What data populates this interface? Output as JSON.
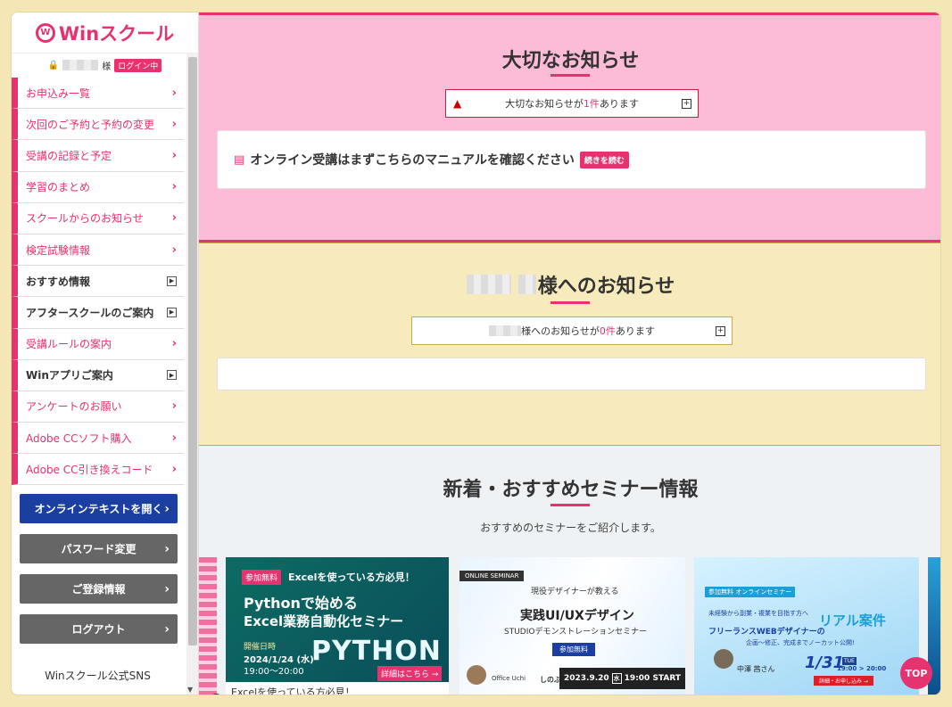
{
  "logo": {
    "text": "Winスクール",
    "mark": "W"
  },
  "user": {
    "suffix": "様",
    "badge": "ログイン中"
  },
  "sidebar": {
    "items": [
      {
        "label": "お申込み一覧",
        "kind": "arrow"
      },
      {
        "label": "次回のご予約と予約の変更",
        "kind": "arrow"
      },
      {
        "label": "受講の記録と予定",
        "kind": "arrow"
      },
      {
        "label": "学習のまとめ",
        "kind": "arrow"
      },
      {
        "label": "スクールからのお知らせ",
        "kind": "arrow"
      },
      {
        "label": "検定試験情報",
        "kind": "arrow"
      },
      {
        "label": "おすすめ情報",
        "kind": "box"
      },
      {
        "label": "アフタースクールのご案内",
        "kind": "box"
      },
      {
        "label": "受講ルールの案内",
        "kind": "arrow"
      },
      {
        "label": "Winアプリご案内",
        "kind": "box"
      },
      {
        "label": "アンケートのお願い",
        "kind": "arrow"
      },
      {
        "label": "Adobe CCソフト購入",
        "kind": "arrow"
      },
      {
        "label": "Adobe CC引き換えコード",
        "kind": "arrow"
      }
    ],
    "buttons": {
      "online_text": "オンラインテキストを開く",
      "password": "パスワード変更",
      "registration": "ご登録情報",
      "logout": "ログアウト"
    },
    "sns": "Winスクール公式SNS"
  },
  "important": {
    "title": "大切なお知らせ",
    "notice_pre": "大切なお知らせが",
    "notice_count": "1件",
    "notice_post": "あります",
    "manual_text": "オンライン受講はまずこちらのマニュアルを確認ください",
    "read_more": "続きを読む"
  },
  "personal": {
    "title": "様へのお知らせ",
    "notice_pre": "様へのお知らせが",
    "notice_count": "0件",
    "notice_post": "あります"
  },
  "seminar": {
    "title": "新着・おすすめセミナー情報",
    "subtitle": "おすすめのセミナーをご紹介します。",
    "card1": {
      "badge": "参加無料",
      "ribbon": "Excelを使っている方必見！",
      "title1": "Pythonで始める",
      "title2": "Excel業務自動化セミナー",
      "date_label": "開催日時",
      "date": "2024/1/24",
      "weekday": "(水)",
      "time": "19:00～20:00",
      "bigword": "PYTHON",
      "detail": "詳細はこちら →",
      "caption": "Excelを使っている方必見！"
    },
    "card2": {
      "tag": "ONLINE SEMINAR",
      "lead": "現役デザイナーが教える",
      "title": "実践UI/UXデザイン",
      "sub": "STUDIOデモンストレーションセミナー",
      "badge": "参加無料",
      "speaker_org": "Office Uchi",
      "speaker": "しのぶ",
      "date": "2023.9.20",
      "weekday": "水",
      "time": "19:00 START"
    },
    "card3": {
      "tag": "参加無料 オンラインセミナー",
      "lead": "未経験から副業・複業を目指す方へ",
      "line2": "フリーランスWEBデザイナーの",
      "highlight": "リアル案件",
      "line3": "企画〜修正、完成までノーカット公開!",
      "speaker": "中澤 茜さん",
      "date": "1/31",
      "weekday": "TUE",
      "time": "19:00 > 20:00",
      "detail": "詳細・お申し込み →"
    }
  },
  "top_button": "TOP",
  "colors": {
    "accent": "#e6326e",
    "navy": "#1a3fa0"
  }
}
